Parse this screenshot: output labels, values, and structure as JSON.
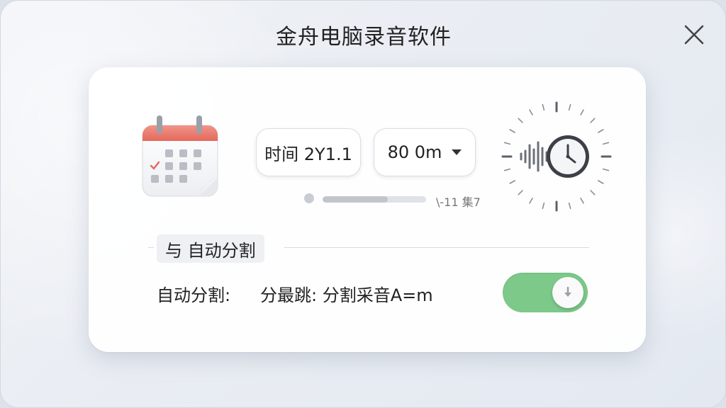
{
  "window": {
    "title": "金舟电脑录音软件"
  },
  "timer": {
    "time_pill_label": "时间 2Y1.1",
    "duration_pill_label": "80  0m",
    "progress_fraction": 0.63,
    "progress_label": "\\-11 集7"
  },
  "section": {
    "tag_label": "与 自动分割"
  },
  "setting": {
    "label": "自动分割:",
    "description": "分最跳: 分割采音A=m",
    "toggle_on": true
  },
  "colors": {
    "toggle_on": "#7cc98a",
    "calendar_header": "#ea7b6f",
    "panel_bg": "#ffffff"
  },
  "icons": {
    "close": "close-icon",
    "calendar": "calendar-icon",
    "clock": "clock-waveform-icon",
    "caret": "chevron-down-icon",
    "toggle_knob": "arrow-down-icon"
  }
}
